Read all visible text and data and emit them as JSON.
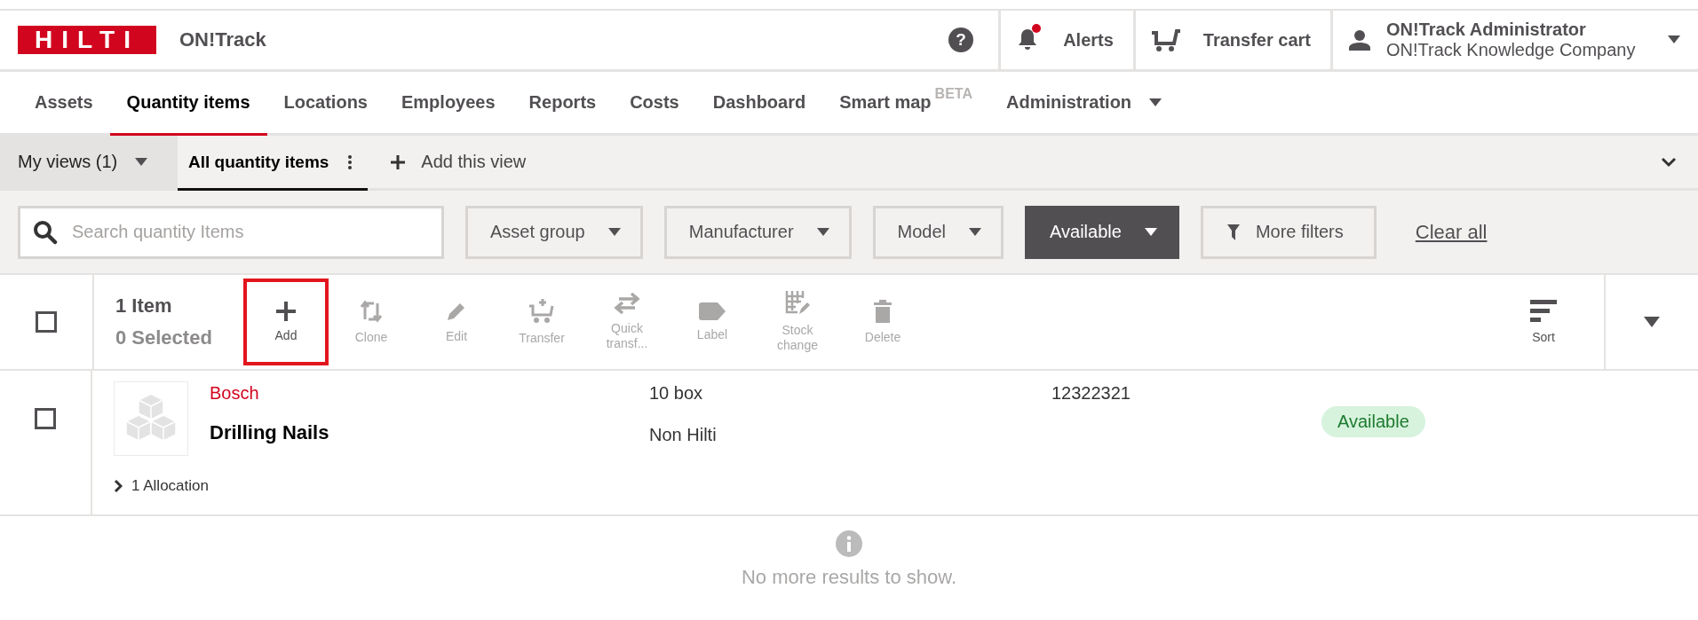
{
  "header": {
    "logo": "HILTI",
    "app_name": "ON!Track",
    "help": "?",
    "alerts": {
      "label": "Alerts",
      "unread": true
    },
    "transfer_cart": "Transfer cart",
    "user": {
      "name": "ON!Track Administrator",
      "company": "ON!Track Knowledge Company"
    }
  },
  "nav": [
    {
      "label": "Assets",
      "selected": false
    },
    {
      "label": "Quantity items",
      "selected": true
    },
    {
      "label": "Locations",
      "selected": false
    },
    {
      "label": "Employees",
      "selected": false
    },
    {
      "label": "Reports",
      "selected": false
    },
    {
      "label": "Costs",
      "selected": false
    },
    {
      "label": "Dashboard",
      "selected": false
    },
    {
      "label": "Smart map",
      "badge": "BETA",
      "selected": false
    },
    {
      "label": "Administration",
      "dropdown": true,
      "selected": false
    }
  ],
  "views": {
    "my_views": "My views (1)",
    "tabs": [
      {
        "label": "All quantity items",
        "selected": true
      }
    ],
    "add_view": "Add this view"
  },
  "search": {
    "placeholder": "Search quantity Items"
  },
  "filters": [
    {
      "kind": "dropdown",
      "label": "Asset group",
      "active": false
    },
    {
      "kind": "dropdown",
      "label": "Manufacturer",
      "active": false
    },
    {
      "kind": "dropdown",
      "label": "Model",
      "active": false
    },
    {
      "kind": "dropdown",
      "label": "Available",
      "active": true
    },
    {
      "kind": "more",
      "label": "More filters",
      "active": false
    }
  ],
  "clear_all": "Clear all",
  "toolbar": {
    "count": "1 Item",
    "selected": "0 Selected",
    "select_all": {
      "checked": false
    },
    "actions": [
      {
        "label": "Add",
        "disabled": false,
        "highlighted": true
      },
      {
        "label": "Clone",
        "disabled": true,
        "highlighted": false
      },
      {
        "label": "Edit",
        "disabled": true,
        "highlighted": false
      },
      {
        "label": "Transfer",
        "disabled": true,
        "highlighted": false
      },
      {
        "label": "Quick transf...",
        "disabled": true,
        "highlighted": false
      },
      {
        "label": "Label",
        "disabled": true,
        "highlighted": false
      },
      {
        "label": "Stock change",
        "disabled": true,
        "highlighted": false
      },
      {
        "label": "Delete",
        "disabled": true,
        "highlighted": false
      }
    ],
    "sort": "Sort"
  },
  "rows": [
    {
      "checked": false,
      "manufacturer": "Bosch",
      "name": "Drilling Nails",
      "quantity": "10 box",
      "brand": "Non Hilti",
      "column_4": "12322321",
      "status": "Available",
      "allocation": "1 Allocation"
    }
  ],
  "footer_message": "No more results to show."
}
